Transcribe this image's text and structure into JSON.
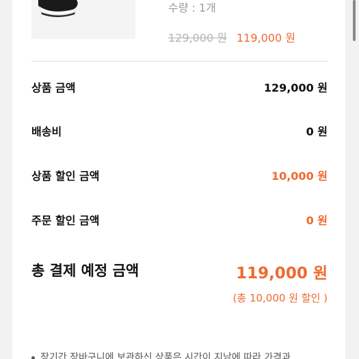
{
  "product": {
    "image_icon": "sneaker-image",
    "quantity_text": "수량 : 1개",
    "original_price": "129,000 원",
    "sale_price": "119,000 원"
  },
  "summary": {
    "rows": [
      {
        "label": "상품 금액",
        "value": "129,000 원"
      },
      {
        "label": "배송비",
        "value": "0 원"
      },
      {
        "label": "상품 할인 금액",
        "value": "10,000 원"
      },
      {
        "label": "주문 할인 금액",
        "value": "0 원"
      }
    ],
    "total_label": "총 결제 예정 금액",
    "total_value": "119,000 원",
    "discount_note": "(총 10,000 원 할인 )"
  },
  "notice": {
    "text": "장기간 장바구니에 보관하신 상품은 시간이 지남에 따라 가격과"
  },
  "colors": {
    "accent": "#ef6a2f",
    "background": "#f2f2f2",
    "card": "#ffffff"
  }
}
